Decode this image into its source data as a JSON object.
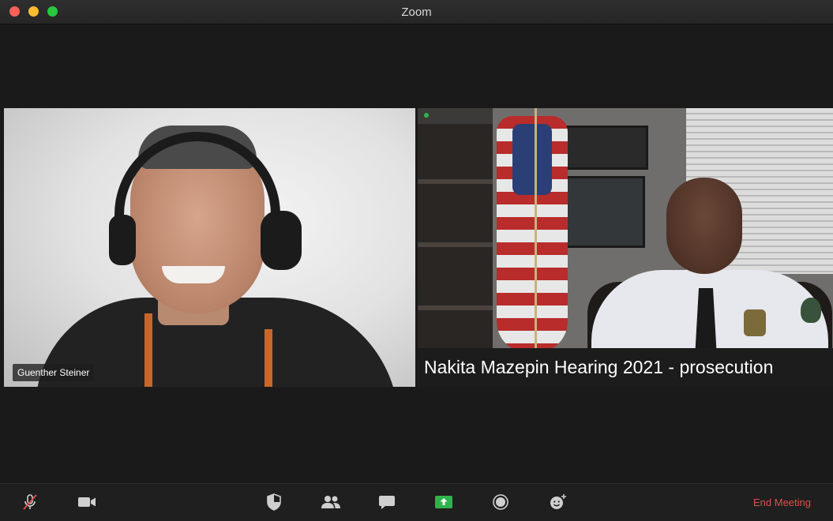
{
  "window": {
    "title": "Zoom"
  },
  "participants": [
    {
      "name": "Guenther Steiner"
    },
    {
      "caption": "Nakita Mazepin Hearing 2021 - prosecution"
    }
  ],
  "toolbar": {
    "icons": [
      "microphone-muted-icon",
      "video-camera-icon",
      "security-shield-icon",
      "participants-icon",
      "chat-icon",
      "share-screen-icon",
      "record-icon",
      "reactions-icon"
    ],
    "end_meeting_label": "End Meeting",
    "colors": {
      "share_accent": "#2fb34a",
      "end_meeting": "#e0504a"
    }
  }
}
